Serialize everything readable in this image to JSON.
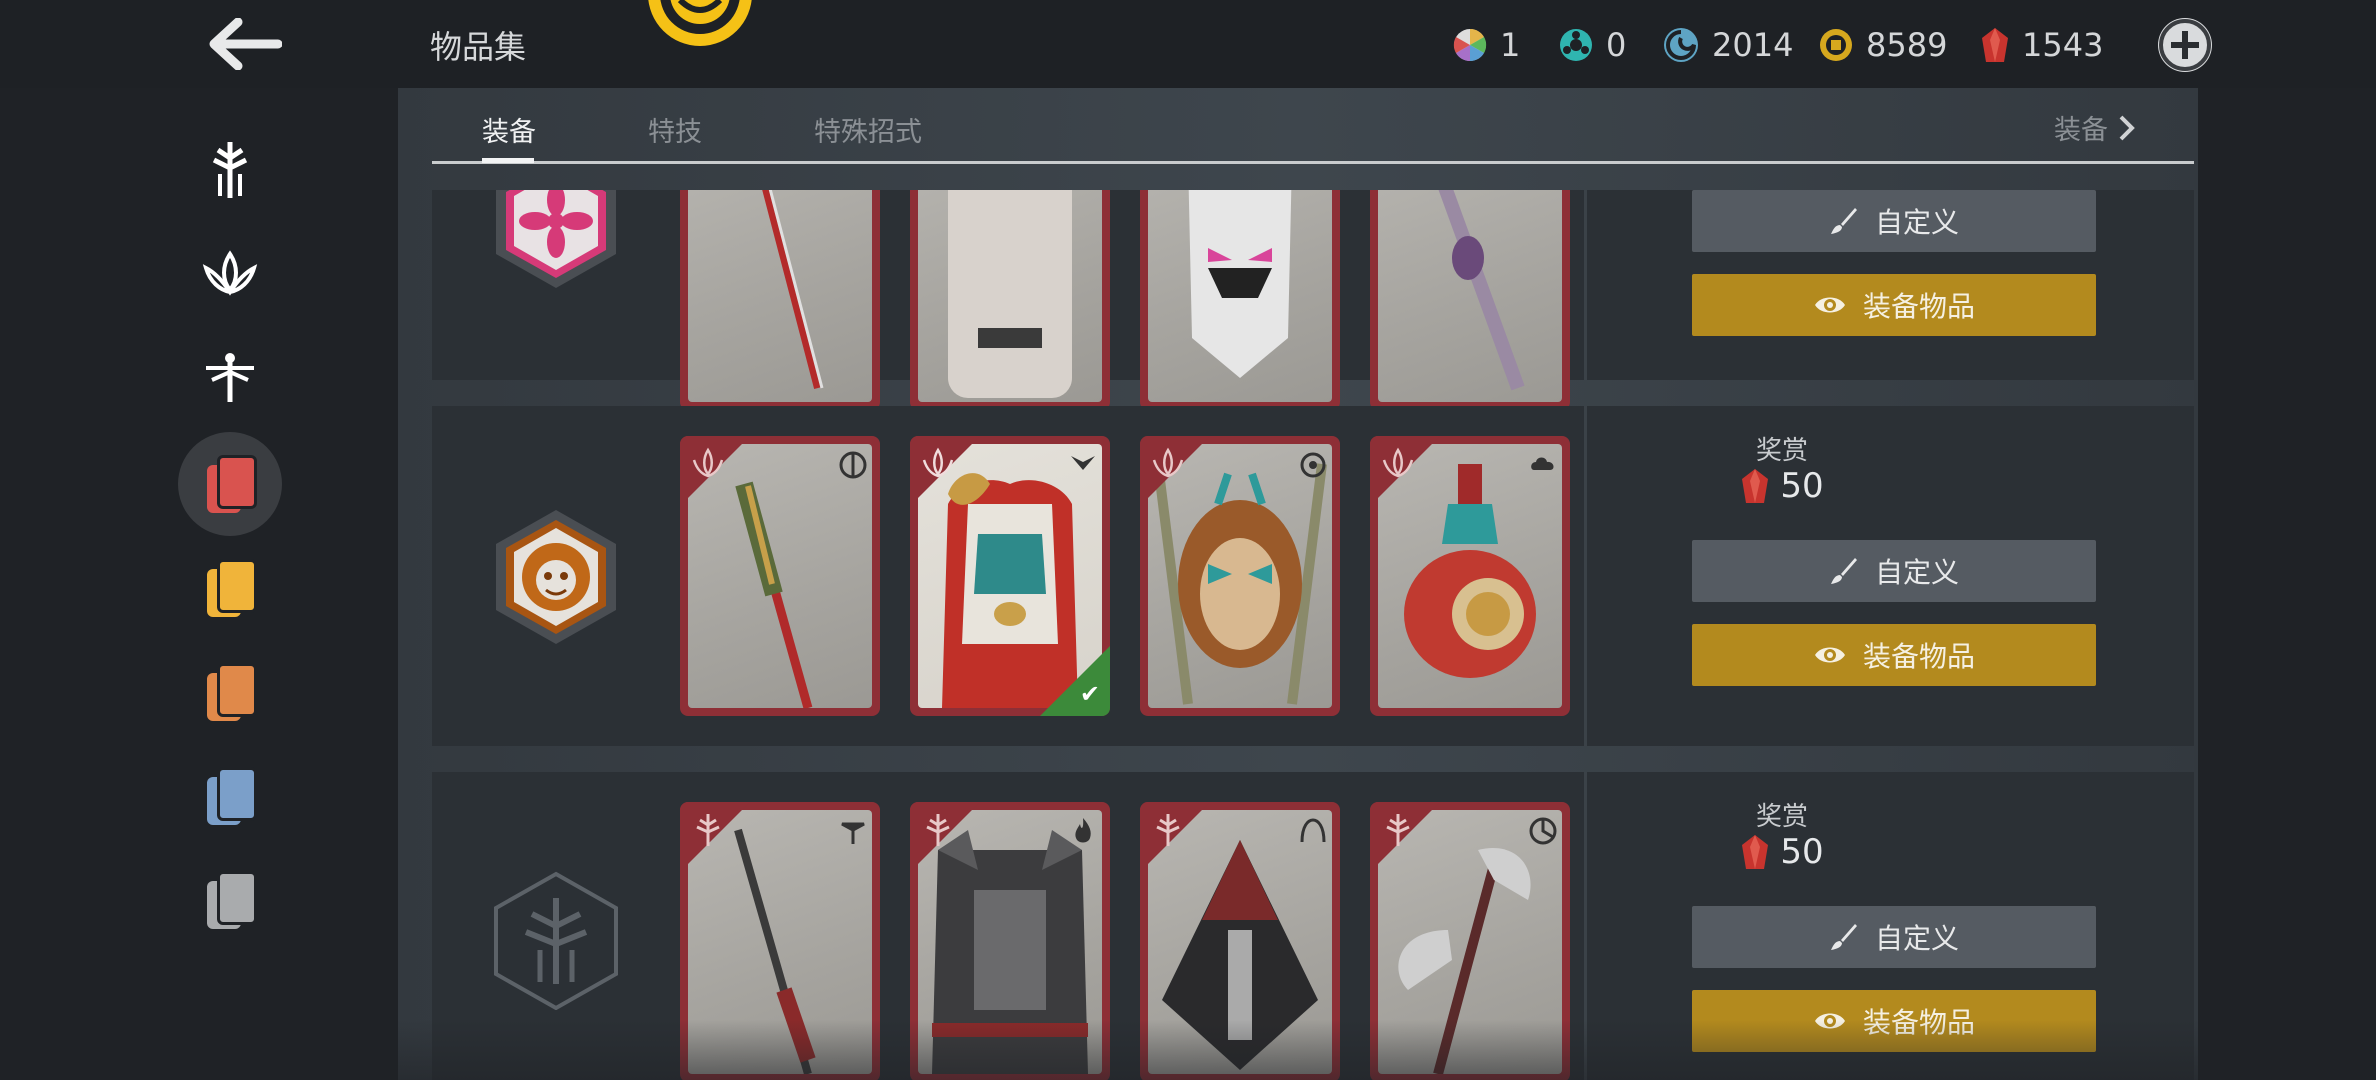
{
  "header": {
    "title": "物品集",
    "currencies": [
      {
        "icon": "multicolor-orb-icon",
        "value": "1",
        "color": "#e4b54a"
      },
      {
        "icon": "steel-token-icon",
        "value": "0",
        "color": "#2fb5b0"
      },
      {
        "icon": "swirl-icon",
        "value": "2014",
        "color": "#5ea4c4"
      },
      {
        "icon": "gold-coin-icon",
        "value": "8589",
        "color": "#d6a81e"
      },
      {
        "icon": "red-crystal-icon",
        "value": "1543",
        "color": "#c8342e"
      }
    ],
    "add_button_icon": "plus-icon"
  },
  "sidebar": {
    "items": [
      {
        "icon": "knight-faction-icon",
        "color": "#ffffff"
      },
      {
        "icon": "samurai-lotus-icon",
        "color": "#ffffff"
      },
      {
        "icon": "wu-lin-dragonfly-icon",
        "color": "#ffffff"
      },
      {
        "icon": "red-card-deck-icon",
        "color": "#d9534f",
        "active": true
      },
      {
        "icon": "yellow-card-deck-icon",
        "color": "#f0b43a"
      },
      {
        "icon": "orange-card-deck-icon",
        "color": "#e0894a"
      },
      {
        "icon": "blue-card-deck-icon",
        "color": "#7b9fc9"
      },
      {
        "icon": "grey-card-deck-icon",
        "color": "#a9abad"
      }
    ]
  },
  "tabs": {
    "items": [
      "装备",
      "特技",
      "特殊招式"
    ],
    "active": "装备",
    "right_label": "装备"
  },
  "sets": [
    {
      "badge": "samurai-flower-badge",
      "reward_label": "",
      "reward_value": "",
      "customize_label": "自定义",
      "equip_label": "装备物品",
      "cards": [
        "sword-item",
        "chest-armor-item",
        "helmet-mask-item",
        "blade-item"
      ]
    },
    {
      "badge": "lion-emblem-badge",
      "reward_label": "奖赏",
      "reward_value": "50",
      "customize_label": "自定义",
      "equip_label": "装备物品",
      "cards": [
        "staff-item",
        "chest-armor-item",
        "monkey-helmet-item",
        "gourd-item"
      ]
    },
    {
      "badge": "knight-emblem-badge",
      "reward_label": "奖赏",
      "reward_value": "50",
      "customize_label": "自定义",
      "equip_label": "装备物品",
      "cards": [
        "spear-item",
        "dark-armor-item",
        "hood-helmet-item",
        "axe-item"
      ]
    }
  ]
}
